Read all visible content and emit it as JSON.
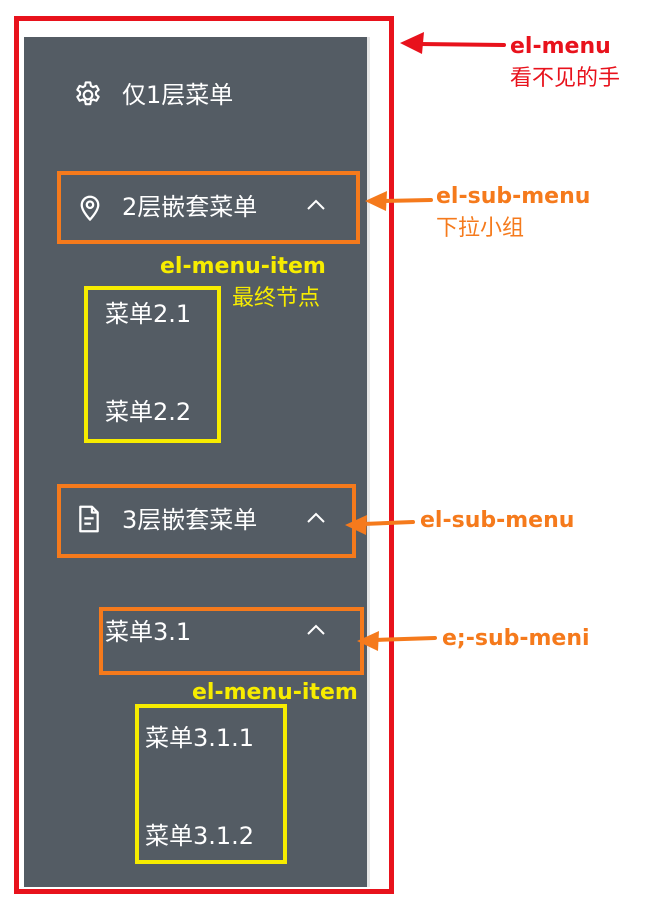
{
  "colors": {
    "menu_bg": "#545c64",
    "menu_text": "#ffffff",
    "red": "#e8121c",
    "orange": "#f57a1c",
    "yellow": "#f7ec00"
  },
  "menu": {
    "item1": {
      "label": "仅1层菜单",
      "icon": "gear-icon"
    },
    "sub2": {
      "label": "2层嵌套菜单",
      "icon": "location-pin-icon",
      "children": [
        "菜单2.1",
        "菜单2.2"
      ]
    },
    "sub3": {
      "label": "3层嵌套菜单",
      "icon": "document-icon",
      "sub31": {
        "label": "菜单3.1",
        "children": [
          "菜单3.1.1",
          "菜单3.1.2"
        ]
      }
    }
  },
  "annotations": {
    "el_menu": {
      "name": "el-menu",
      "desc": "看不见的手"
    },
    "el_sub_menu_1": {
      "name": "el-sub-menu",
      "desc": "下拉小组"
    },
    "el_menu_item_1": {
      "name": "el-menu-item",
      "desc": "最终节点"
    },
    "el_sub_menu_2": {
      "name": "el-sub-menu"
    },
    "el_sub_menu_3": {
      "name": "e;-sub-meni"
    },
    "el_menu_item_2": {
      "name": "el-menu-item"
    }
  }
}
